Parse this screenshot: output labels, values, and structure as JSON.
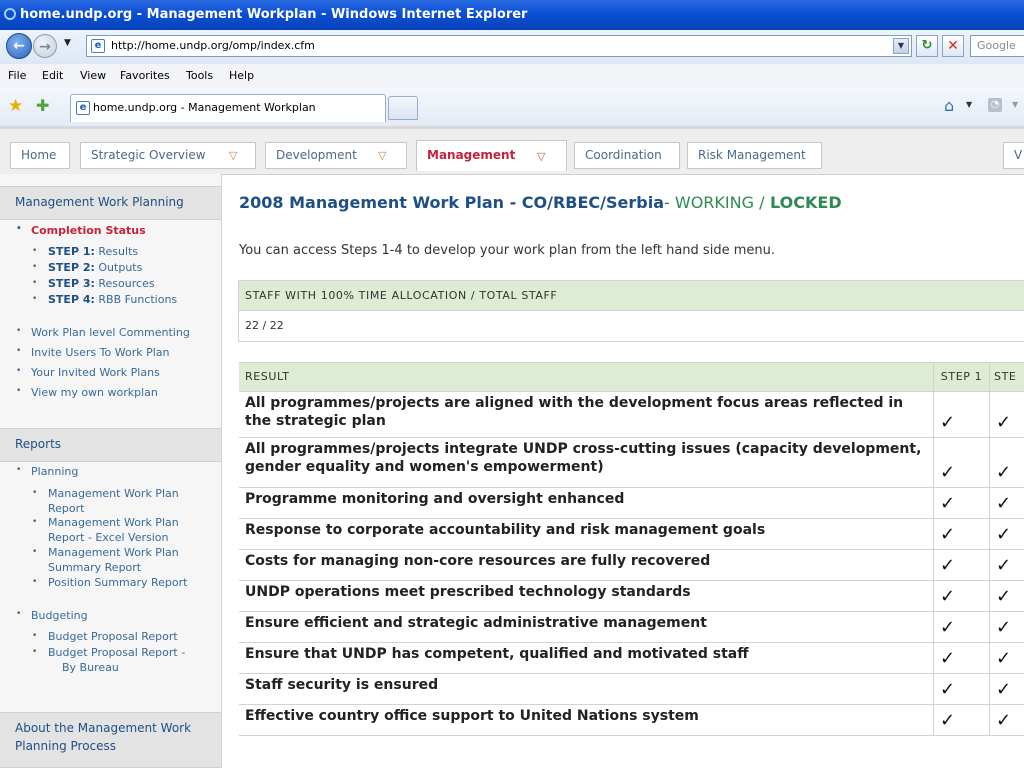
{
  "browser": {
    "title": "home.undp.org - Management Workplan - Windows Internet Explorer",
    "url": "http://home.undp.org/omp/index.cfm",
    "search_placeholder": "Google",
    "menu": [
      "File",
      "Edit",
      "View",
      "Favorites",
      "Tools",
      "Help"
    ],
    "tab_title": "home.undp.org - Management Workplan"
  },
  "site_nav": {
    "tabs": [
      {
        "label": "Home"
      },
      {
        "label": "Strategic Overview"
      },
      {
        "label": "Development"
      },
      {
        "label": "Management"
      },
      {
        "label": "Coordination"
      },
      {
        "label": "Risk Management"
      },
      {
        "label": "V"
      }
    ]
  },
  "sidebar": {
    "section1_title": "Management Work Planning",
    "completion_status": "Completion Status",
    "steps": [
      {
        "step": "STEP 1:",
        "label": "Results"
      },
      {
        "step": "STEP 2:",
        "label": "Outputs"
      },
      {
        "step": "STEP 3:",
        "label": "Resources"
      },
      {
        "step": "STEP 4:",
        "label": "RBB Functions"
      }
    ],
    "links": [
      "Work Plan level Commenting",
      "Invite Users To Work Plan",
      "Your Invited Work Plans",
      "View my own workplan"
    ],
    "reports_title": "Reports",
    "planning_label": "Planning",
    "planning_reports": [
      {
        "line1": "Management Work Plan",
        "line2": "Report"
      },
      {
        "line1": "Management Work Plan",
        "line2": "Report - Excel Version"
      },
      {
        "line1": "Management Work Plan",
        "line2": "Summary Report"
      },
      {
        "line1": "Position Summary Report",
        "line2": ""
      }
    ],
    "budgeting_label": "Budgeting",
    "budget_reports": [
      {
        "line1": "Budget Proposal Report",
        "line2": ""
      },
      {
        "line1": "Budget Proposal Report -",
        "line2": "By Bureau"
      }
    ],
    "about_line1": "About the Management Work",
    "about_line2": "Planning Process"
  },
  "main": {
    "title_main": "2008 Management Work Plan - ",
    "title_org": "CO/RBEC/Serbia",
    "title_dash": "- ",
    "status_working": "WORKING /",
    "status_locked": " LOCKED",
    "intro": "You can access Steps 1-4 to develop your work plan from the left hand side menu.",
    "staff_header": "STAFF WITH 100% TIME ALLOCATION / TOTAL STAFF",
    "staff_value": "22 / 22",
    "result_header": "RESULT",
    "step1_header": "STEP 1",
    "step2_header": "STE",
    "check_symbol": "✓",
    "results": [
      {
        "text": "All programmes/projects are aligned with the development focus areas reflected in the strategic plan",
        "step1": true,
        "step2": true
      },
      {
        "text": "All programmes/projects integrate UNDP cross-cutting issues (capacity development, gender equality and women's empowerment)",
        "step1": true,
        "step2": true
      },
      {
        "text": "Programme monitoring and oversight enhanced",
        "step1": true,
        "step2": true
      },
      {
        "text": "Response to corporate accountability and risk management goals",
        "step1": true,
        "step2": true
      },
      {
        "text": "Costs for managing non-core resources are fully recovered",
        "step1": true,
        "step2": true
      },
      {
        "text": "UNDP operations meet prescribed technology standards",
        "step1": true,
        "step2": true
      },
      {
        "text": "Ensure efficient and strategic administrative management",
        "step1": true,
        "step2": true
      },
      {
        "text": "Ensure that UNDP has competent, qualified and motivated staff",
        "step1": true,
        "step2": true
      },
      {
        "text": "Staff security is ensured",
        "step1": true,
        "step2": true
      },
      {
        "text": "Effective country office support to United Nations system",
        "step1": true,
        "step2": true
      }
    ]
  }
}
